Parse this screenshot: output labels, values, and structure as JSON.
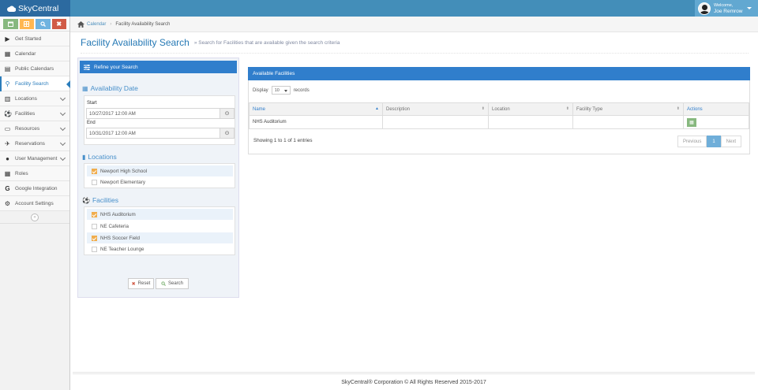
{
  "app": {
    "brand": "SkyCentral"
  },
  "user": {
    "welcome": "Welcome,",
    "name": "Joe Remrow"
  },
  "shortcuts": [
    {
      "icon": "calendar-icon",
      "color": "#87b87f"
    },
    {
      "icon": "grid-icon",
      "color": "#ffb752"
    },
    {
      "icon": "search-icon",
      "color": "#6fb3e0"
    },
    {
      "icon": "close-icon",
      "color": "#d15b47"
    }
  ],
  "sidebar": {
    "items": [
      {
        "label": "Get Started",
        "icon": "play-icon"
      },
      {
        "label": "Calendar",
        "icon": "calendar-icon"
      },
      {
        "label": "Public Calendars",
        "icon": "calendar-icon"
      },
      {
        "label": "Facility Search",
        "icon": "search-icon"
      },
      {
        "label": "Locations",
        "icon": "map-icon"
      },
      {
        "label": "Facilities",
        "icon": "soccer-icon"
      },
      {
        "label": "Resources",
        "icon": "desktop-icon"
      },
      {
        "label": "Reservations",
        "icon": "plane-icon"
      },
      {
        "label": "User Management",
        "icon": "users-icon"
      },
      {
        "label": "Roles",
        "icon": "th-icon"
      },
      {
        "label": "Google Integration",
        "icon": "google-icon"
      },
      {
        "label": "Account Settings",
        "icon": "gear-icon"
      }
    ],
    "collapse": "«"
  },
  "breadcrumb": {
    "home": "Calendar",
    "current": "Facility Availability Search"
  },
  "page": {
    "title": "Facility Availability Search",
    "subtitle": "» Search for Facilities that are available given the search criteria"
  },
  "refine": {
    "title": "Refine your Search",
    "availability_title": "Availability Date",
    "start_label": "Start",
    "start_value": "10/27/2017 12:00 AM",
    "end_label": "End",
    "end_value": "10/31/2017 12:00 AM",
    "locations_title": "Locations",
    "locations": [
      {
        "label": "Newport High School",
        "checked": true
      },
      {
        "label": "Newport Elementary",
        "checked": false
      }
    ],
    "facilities_title": "Facilities",
    "facilities": [
      {
        "label": "NHS Auditorium",
        "checked": true
      },
      {
        "label": "NE Cafeteria",
        "checked": false
      },
      {
        "label": "NHS Soccer Field",
        "checked": true
      },
      {
        "label": "NE Teacher Lounge",
        "checked": false
      }
    ],
    "reset_label": "Reset",
    "search_label": "Search"
  },
  "results": {
    "title": "Available Facilities",
    "display_label": "Display",
    "display_value": "10",
    "records_label": "records",
    "columns": [
      "Name",
      "Description",
      "Location",
      "Facility Type",
      "Actions"
    ],
    "rows": [
      {
        "name": "NHS Auditorium",
        "description": "",
        "location": "",
        "type": ""
      }
    ],
    "showing": "Showing 1 to 1 of 1 entries",
    "pager": {
      "prev": "Previous",
      "current": "1",
      "next": "Next"
    }
  },
  "footer": {
    "text": "SkyCentral® Corporation © All Rights Reserved 2015-2017"
  }
}
